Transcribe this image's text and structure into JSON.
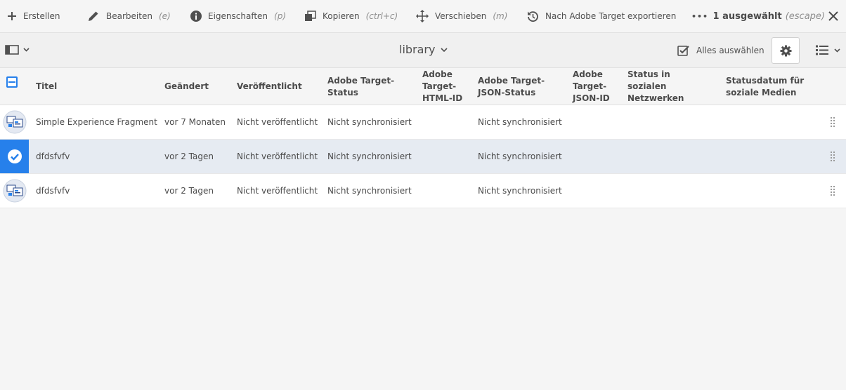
{
  "actions": {
    "create": "Erstellen",
    "edit": "Bearbeiten",
    "edit_kbd": "(e)",
    "properties": "Eigenschaften",
    "properties_kbd": "(p)",
    "copy": "Kopieren",
    "copy_kbd": "(ctrl+c)",
    "move": "Verschieben",
    "move_kbd": "(m)",
    "export": "Nach Adobe Target exportieren",
    "more": "•••",
    "selection": "1 ausgewählt",
    "selection_kbd": "(escape)"
  },
  "toolbar": {
    "title": "library",
    "select_all": "Alles auswählen"
  },
  "columns": [
    "Titel",
    "Geändert",
    "Veröffentlicht",
    "Adobe Target-Status",
    "Adobe Target-HTML-ID",
    "Adobe Target-JSON-Status",
    "Adobe Target-JSON-ID",
    "Status in sozialen Netzwerken",
    "Statusdatum für soziale Medien"
  ],
  "rows": [
    {
      "title": "Simple Experience Fragment",
      "modified": "vor 7 Monaten",
      "published": "Nicht veröffentlicht",
      "target_status": "Nicht synchronisiert",
      "html_id": "",
      "json_status": "Nicht synchronisiert",
      "json_id": "",
      "social_status": "",
      "social_date": "",
      "selected": false
    },
    {
      "title": "dfdsfvfv",
      "modified": "vor 2 Tagen",
      "published": "Nicht veröffentlicht",
      "target_status": "Nicht synchronisiert",
      "html_id": "",
      "json_status": "Nicht synchronisiert",
      "json_id": "",
      "social_status": "",
      "social_date": "",
      "selected": true
    },
    {
      "title": "dfdsfvfv",
      "modified": "vor 2 Tagen",
      "published": "Nicht veröffentlicht",
      "target_status": "Nicht synchronisiert",
      "html_id": "",
      "json_status": "Nicht synchronisiert",
      "json_id": "",
      "social_status": "",
      "social_date": "",
      "selected": false
    }
  ],
  "colors": {
    "accent": "#2680eb",
    "selected_row": "#e6ebf2"
  }
}
